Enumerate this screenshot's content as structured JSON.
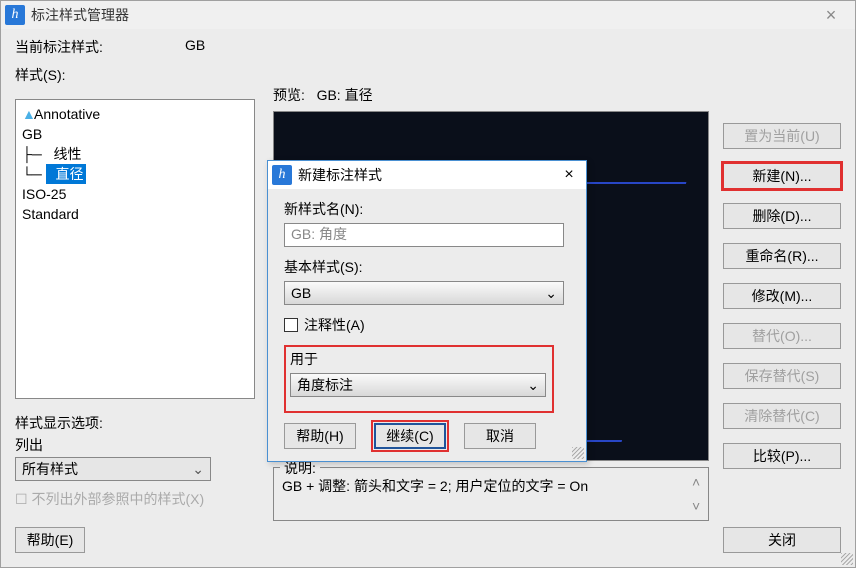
{
  "window": {
    "title": "标注样式管理器",
    "close_glyph": "×"
  },
  "current": {
    "label": "当前标注样式:",
    "value": "GB"
  },
  "styles_label": "样式(S):",
  "styles_tree": {
    "items": [
      {
        "text": "Annotative",
        "icon": true
      },
      {
        "text": "GB"
      },
      {
        "text": "  线性",
        "indent": true
      },
      {
        "text": "  直径",
        "indent": true,
        "selected": true
      },
      {
        "text": "ISO-25"
      },
      {
        "text": "Standard"
      }
    ]
  },
  "display_opts": {
    "heading": "样式显示选项:",
    "list_label": "列出",
    "combo_value": "所有样式",
    "chk_disabled": "不列出外部参照中的样式(X)"
  },
  "preview": {
    "label": "预览:",
    "value": "GB: 直径"
  },
  "desc": {
    "label": "说明:",
    "text": "GB + 调整: 箭头和文字 = 2; 用户定位的文字 = On"
  },
  "buttons": {
    "set_current": "置为当前(U)",
    "new": "新建(N)...",
    "delete": "删除(D)...",
    "rename": "重命名(R)...",
    "modify": "修改(M)...",
    "override": "替代(O)...",
    "save_override": "保存替代(S)",
    "clear_override": "清除替代(C)",
    "compare": "比较(P)...",
    "close": "关闭",
    "help": "帮助(E)"
  },
  "dialog": {
    "title": "新建标注样式",
    "close_glyph": "×",
    "new_name_label": "新样式名(N):",
    "new_name_value": "GB: 角度",
    "base_label": "基本样式(S):",
    "base_value": "GB",
    "annotative_label": "注释性(A)",
    "use_for_label": "用于",
    "use_for_value": "角度标注",
    "btn_help": "帮助(H)",
    "btn_continue": "继续(C)",
    "btn_cancel": "取消"
  }
}
